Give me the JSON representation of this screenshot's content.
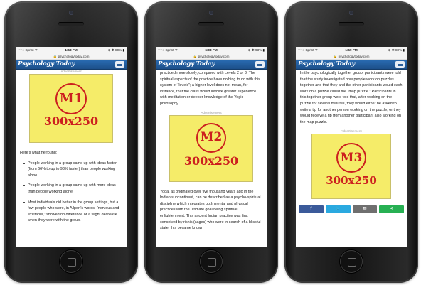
{
  "colors": {
    "site_blue": "#1c4f89",
    "ad_yellow": "#f5ec69",
    "ad_red": "#cc1f1f",
    "facebook": "#3b5a9a",
    "twitter": "#2aa9e0",
    "email": "#6f6f6f",
    "share": "#27b053"
  },
  "phones": [
    {
      "status": {
        "carrier": "••••○ Sprint ᯤ",
        "time": "1:58 PM",
        "battery": "⊕ ✱ 80% ▮"
      },
      "url": "🔒 psychologytoday.com",
      "logo": "Psychology Today",
      "ad_label": "Advertisement",
      "ad": {
        "code": "M1",
        "size": "300x250"
      },
      "intro": "Here's what he found:",
      "bullets": [
        "People working in a group came up with ideas faster (from 66% to up to 93% faster) than people working alone.",
        "People working in a group came up with more ideas than people working alone.",
        "Most individuals did better in the group settings, but a few people who were, in Allport's words, “nervous and excitable,” showed no difference or a slight decrease when they were with the group."
      ]
    },
    {
      "status": {
        "carrier": "••••○ Sprint ᯤ",
        "time": "6:03 PM",
        "battery": "⊕ ✱ 93% ▮"
      },
      "url": "🔒 psychologytoday.com",
      "logo": "Psychology Today",
      "text_top": "practiced more slowly, compared with Levels 2 or 3. The spiritual aspects of the practice have nothing to do with this system of “levels”; a higher level does not mean, for instance, that the class would involve greater experience with meditation or deeper knowledge of the Yogic philosophy.",
      "ad_label": "Advertisement",
      "ad": {
        "code": "M2",
        "size": "300x250"
      },
      "text_bottom": "Yoga, as originated over five thousand years ago in the Indian subcontinent, can be described as a psycho-spiritual discipline which integrates both mental and physical practices with the ultimate goal being spiritual enlightenment. This ancient Indian practice was first conceived by rishis (sages) who were in search of a blissful state; this became known"
    },
    {
      "status": {
        "carrier": "••••○ Sprint ᯤ",
        "time": "1:59 PM",
        "battery": "⊕ ✱ 80% ▮"
      },
      "url": "🔒 psychologytoday.com",
      "logo": "Psychology Today",
      "text_top": "In the psychologically together group, participants were told that the study investigated how people work on puzzles together and that they and the other participants would each work on a puzzle called the “map puzzle.” Participants in this together group were told that, after working on the puzzle for several minutes, they would either be asked to write a tip for another person working on the puzzle, or they would receive a tip from another participant also working on the map puzzle.",
      "ad_label": "Advertisement",
      "ad": {
        "code": "M3",
        "size": "300x250"
      },
      "share": [
        {
          "icon": "facebook-icon",
          "glyph": "f"
        },
        {
          "icon": "twitter-icon",
          "glyph": "🐦"
        },
        {
          "icon": "email-icon",
          "glyph": "✉"
        },
        {
          "icon": "share-icon",
          "glyph": "<"
        }
      ]
    }
  ]
}
